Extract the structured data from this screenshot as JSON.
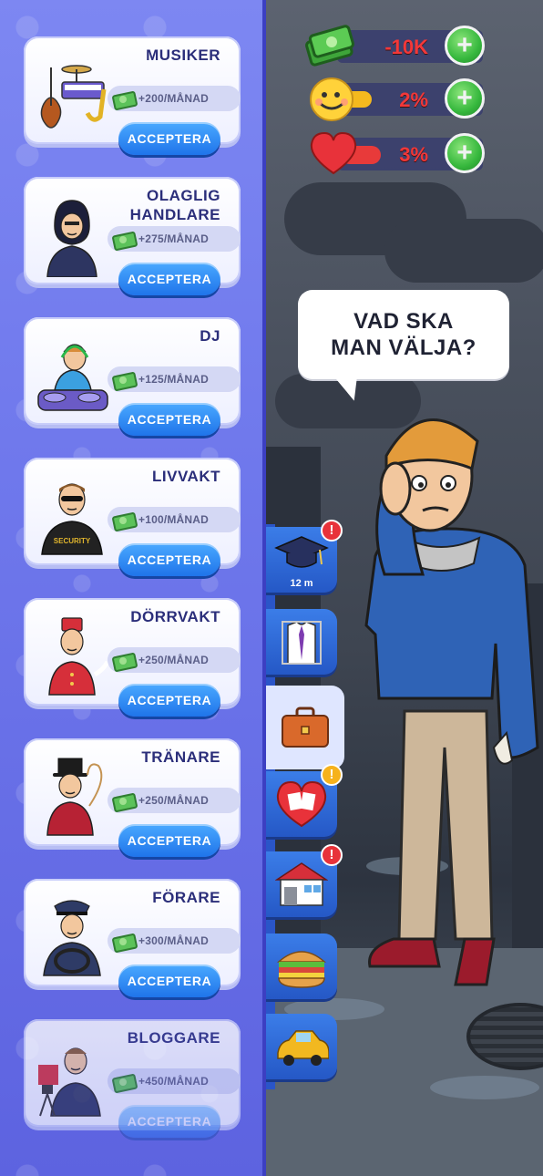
{
  "jobs": [
    {
      "title": "MUSIKER",
      "salary": "+200/MÅNAD",
      "button": "ACCEPTERA",
      "icon": "musician-portrait-icon"
    },
    {
      "title": "OLAGLIG HANDLARE",
      "salary": "+275/MÅNAD",
      "button": "ACCEPTERA",
      "icon": "illegal-dealer-portrait-icon"
    },
    {
      "title": "DJ",
      "salary": "+125/MÅNAD",
      "button": "ACCEPTERA",
      "icon": "dj-portrait-icon"
    },
    {
      "title": "LIVVAKT",
      "salary": "+100/MÅNAD",
      "button": "ACCEPTERA",
      "icon": "bodyguard-portrait-icon",
      "badge": "SECURITY"
    },
    {
      "title": "DÖRRVAKT",
      "salary": "+250/MÅNAD",
      "button": "ACCEPTERA",
      "icon": "doorman-portrait-icon"
    },
    {
      "title": "TRÄNARE",
      "salary": "+250/MÅNAD",
      "button": "ACCEPTERA",
      "icon": "trainer-portrait-icon"
    },
    {
      "title": "FÖRARE",
      "salary": "+300/MÅNAD",
      "button": "ACCEPTERA",
      "icon": "driver-portrait-icon"
    },
    {
      "title": "BLOGGARE",
      "salary": "+450/MÅNAD",
      "button": "ACCEPTERA",
      "icon": "blogger-portrait-icon",
      "disabled": true
    }
  ],
  "stats": {
    "money": {
      "value": "-10K",
      "icon": "money-stack-icon"
    },
    "happiness": {
      "value": "2%",
      "icon": "smiley-icon"
    },
    "health": {
      "value": "3%",
      "icon": "heart-icon"
    }
  },
  "speech": {
    "line1": "VAD SKA",
    "line2": "MAN VÄLJA?"
  },
  "tabs": [
    {
      "name": "education",
      "icon": "graduation-cap-icon",
      "alert": "!",
      "timer": "12 m"
    },
    {
      "name": "clothing",
      "icon": "shirt-icon"
    },
    {
      "name": "work",
      "icon": "briefcase-icon",
      "active": true
    },
    {
      "name": "relationships",
      "icon": "heart-photos-icon",
      "alert": "!",
      "alert_color": "yellow"
    },
    {
      "name": "housing",
      "icon": "house-icon",
      "alert": "!"
    },
    {
      "name": "food",
      "icon": "sandwich-icon"
    },
    {
      "name": "car",
      "icon": "car-icon"
    }
  ],
  "colors": {
    "panel": "#6f78ec",
    "accept_button": "#1f74ea",
    "plus_button": "#34c03a",
    "stat_text": "#ff3535",
    "alert_red": "#e8323a",
    "alert_yellow": "#f6b21c"
  }
}
